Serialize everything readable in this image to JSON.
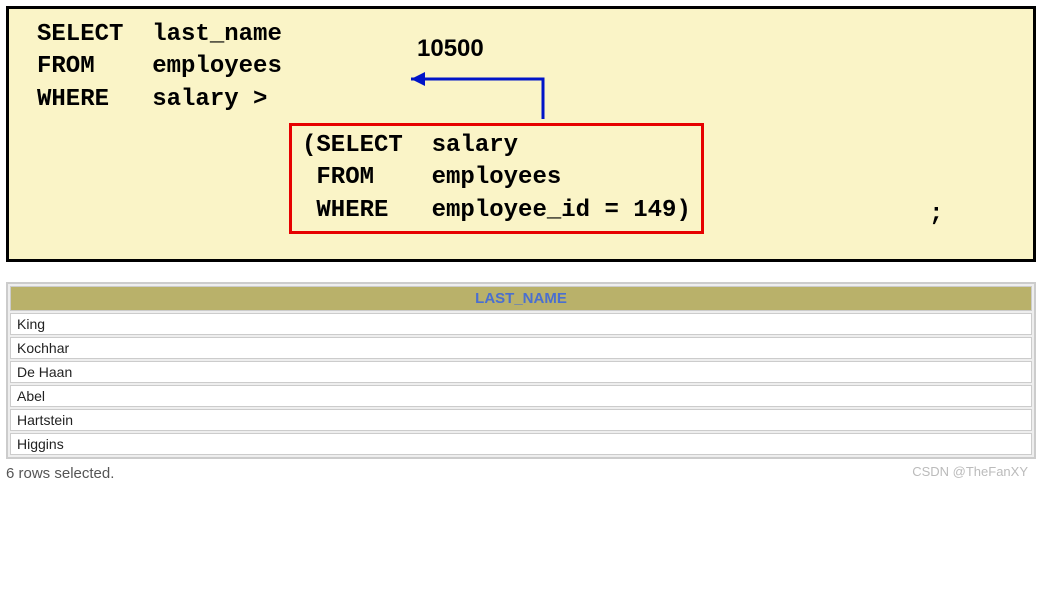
{
  "outer_query": "SELECT  last_name\nFROM    employees\nWHERE   salary >",
  "annotation_value": "10500",
  "subquery_text": "(SELECT  salary\n FROM    employees\n WHERE   employee_id = 149)",
  "semicolon": ";",
  "table": {
    "header": "LAST_NAME",
    "rows": [
      "King",
      "Kochhar",
      "De Haan",
      "Abel",
      "Hartstein",
      "Higgins"
    ]
  },
  "status": "6 rows selected.",
  "watermark": "CSDN @TheFanXY"
}
